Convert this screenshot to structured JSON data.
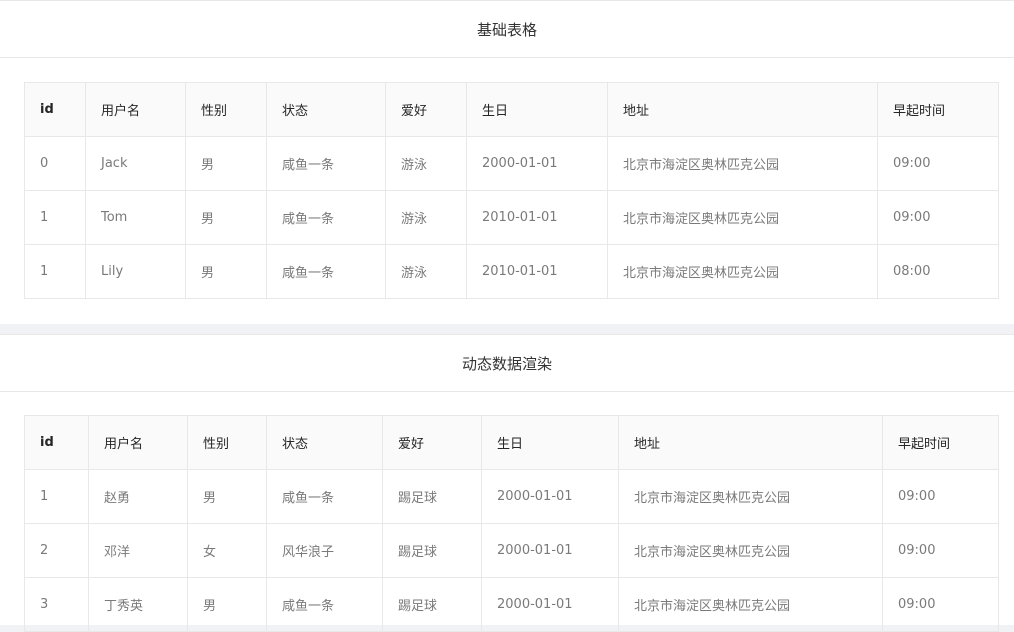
{
  "basic_table": {
    "title": "基础表格",
    "columns": [
      "id",
      "用户名",
      "性别",
      "状态",
      "爱好",
      "生日",
      "地址",
      "早起时间"
    ],
    "rows": [
      [
        "0",
        "Jack",
        "男",
        "咸鱼一条",
        "游泳",
        "2000-01-01",
        "北京市海淀区奥林匹克公园",
        "09:00"
      ],
      [
        "1",
        "Tom",
        "男",
        "咸鱼一条",
        "游泳",
        "2010-01-01",
        "北京市海淀区奥林匹克公园",
        "09:00"
      ],
      [
        "1",
        "Lily",
        "男",
        "咸鱼一条",
        "游泳",
        "2010-01-01",
        "北京市海淀区奥林匹克公园",
        "08:00"
      ]
    ]
  },
  "dynamic_table": {
    "title": "动态数据渲染",
    "columns": [
      "id",
      "用户名",
      "性别",
      "状态",
      "爱好",
      "生日",
      "地址",
      "早起时间"
    ],
    "rows": [
      [
        "1",
        "赵勇",
        "男",
        "咸鱼一条",
        "踢足球",
        "2000-01-01",
        "北京市海淀区奥林匹克公园",
        "09:00"
      ],
      [
        "2",
        "邓洋",
        "女",
        "风华浪子",
        "踢足球",
        "2000-01-01",
        "北京市海淀区奥林匹克公园",
        "09:00"
      ],
      [
        "3",
        "丁秀英",
        "男",
        "咸鱼一条",
        "踢足球",
        "2000-01-01",
        "北京市海淀区奥林匹克公园",
        "09:00"
      ]
    ]
  }
}
